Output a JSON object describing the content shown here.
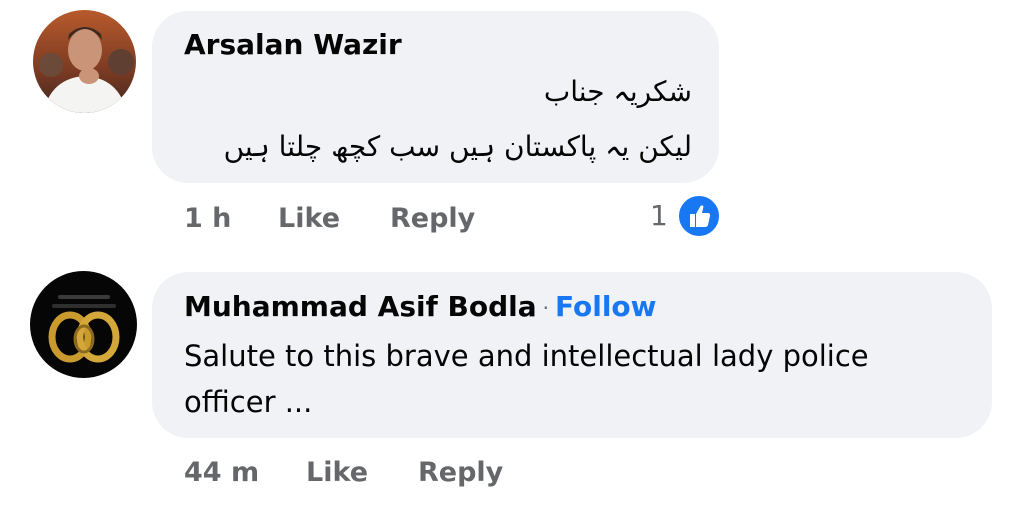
{
  "comments": [
    {
      "author": "Arsalan Wazir",
      "lines": [
        "شکریہ جناب",
        "لیکن یہ پاکستان ہیں سب کچھ چلتا ہیں"
      ],
      "time": "1 h",
      "like_label": "Like",
      "reply_label": "Reply",
      "reaction_count": "1",
      "reaction_icon": "thumbs-up-icon"
    },
    {
      "author": "Muhammad Asif Bodla",
      "follow_label": "Follow",
      "text": "Salute to this brave and intellectual lady police officer ...",
      "time": "44 m",
      "like_label": "Like",
      "reply_label": "Reply"
    }
  ],
  "colors": {
    "bubble": "#f0f2f5",
    "meta": "#65676b",
    "accent": "#1877f2"
  }
}
